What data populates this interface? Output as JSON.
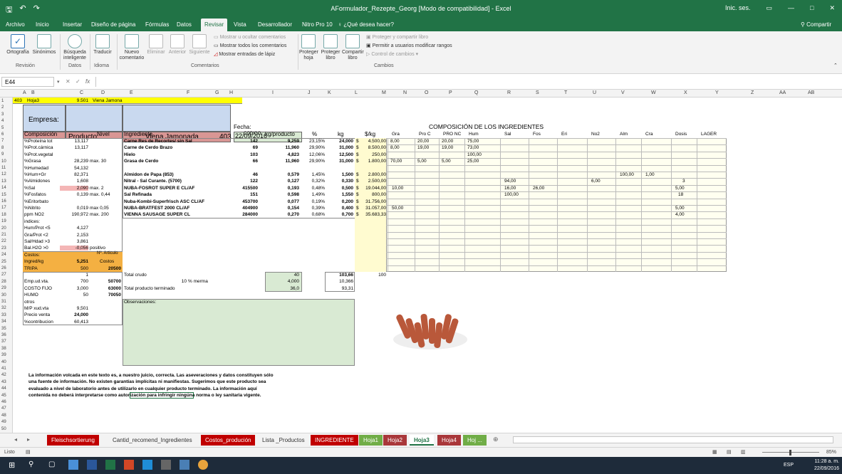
{
  "window": {
    "title": "AFormulador_Rezepte_Georg [Modo de compatibilidad] - Excel",
    "signin": "Inic. ses.",
    "share": "Compartir",
    "min": "—",
    "max": "□",
    "close": "✕"
  },
  "menu": {
    "tabs": [
      "Archivo",
      "Inicio",
      "Insertar",
      "Diseño de página",
      "Fórmulas",
      "Datos",
      "Revisar",
      "Vista",
      "Desarrollador",
      "Nitro Pro 10"
    ],
    "tell": "¿Qué desea hacer?"
  },
  "ribbon": {
    "ortografia": "Ortografía",
    "sinonimos": "Sinónimos",
    "busqueda": "Búsqueda inteligente",
    "traducir": "Traducir",
    "nuevo": "Nuevo comentario",
    "eliminar": "Eliminar",
    "anterior": "Anterior",
    "siguiente": "Siguiente",
    "mostrar_ocultar": "Mostrar u ocultar comentarios",
    "mostrar_todos": "Mostrar todos los comentarios",
    "mostrar_lapiz": "Mostrar entradas de lápiz",
    "proteger_hoja": "Proteger hoja",
    "proteger_libro": "Proteger libro",
    "compartir_libro": "Compartir libro",
    "proteger_compartir": "Proteger y compartir libro",
    "permitir": "Permitir a usuarios modificar rangos",
    "control": "Control de cambios",
    "groups": {
      "revision": "Revisión",
      "datos": "Datos",
      "idioma": "Idioma",
      "comentarios": "Comentarios",
      "cambios": "Cambios"
    }
  },
  "formula": {
    "cell": "E44",
    "fx": "fx"
  },
  "columns": [
    "A",
    "B",
    "C",
    "D",
    "E",
    "F",
    "G",
    "H",
    "I",
    "J",
    "K",
    "L",
    "M",
    "N",
    "O",
    "P",
    "Q",
    "R",
    "S",
    "T",
    "U",
    "V",
    "W",
    "X",
    "Y",
    "Z",
    "AA",
    "AB"
  ],
  "sheet": {
    "r1": [
      "403",
      "Hoja3",
      "9.501",
      "Viena Jamona"
    ],
    "empresa": "Empresa:",
    "producto": "Producto:",
    "producto_nombre": "Viena Jamonada",
    "producto_num": "403",
    "fecha_lbl": "Fecha:",
    "fecha": "22/09/2016",
    "heading": "COMPOSICIÓN DE LOS INGREDIENTES",
    "hdr": {
      "composicion": "Composición",
      "nivel": "Nivel",
      "ingrediente": "Ingrediente",
      "codigo": "CODIGO",
      "kgprod": "kg/producto",
      "pct": "%",
      "kg": "kg",
      "skg": "$/kg"
    },
    "comp_hdr": [
      "Gra",
      "Pro C",
      "PRO NC",
      "Hum",
      "Sal",
      "Fos",
      "Eri",
      "No2",
      "Alm",
      "Cra",
      "Dosis",
      "LAGER"
    ],
    "left": [
      [
        "%Proteína tot",
        "13,117",
        ""
      ],
      [
        "%Prot.cárnica",
        "13,117",
        ""
      ],
      [
        "%Prot.vegetal",
        "",
        ""
      ],
      [
        "%Grasa",
        "28,239",
        "max. 30"
      ],
      [
        "%Humedad",
        "54,132",
        ""
      ],
      [
        "%Hum+Gr",
        "82,371",
        ""
      ],
      [
        "%Almidones",
        "1,608",
        ""
      ],
      [
        "%Sal",
        "2,090",
        "max. 2"
      ],
      [
        "%Fosfatos",
        "0,139",
        "max. 0,44"
      ],
      [
        "%Eritorbato",
        "",
        ""
      ],
      [
        "%Nitrito",
        "0,019",
        "max 0,05"
      ],
      [
        "ppm NO2",
        "190,972",
        "max. 200"
      ],
      [
        "indices:",
        "",
        ""
      ],
      [
        "Hum/Prot <5",
        "4,127",
        ""
      ],
      [
        "Gra/Prot <2",
        "2,153",
        ""
      ],
      [
        "Sal/Hdad >3",
        "3,861",
        ""
      ],
      [
        "Bal.H2O >0",
        "-0,056",
        "positivo"
      ]
    ],
    "ingredients": [
      [
        "Carne Res de Recortes/ sin Sal",
        "142",
        "9,259",
        "23,15%",
        "24,000",
        "$",
        "4.500,00"
      ],
      [
        "Carne de Cerdo Brazo",
        "69",
        "11,960",
        "29,90%",
        "31,000",
        "$",
        "8.500,00"
      ],
      [
        "Hielo",
        "103",
        "4,823",
        "12,06%",
        "12,500",
        "$",
        "250,00"
      ],
      [
        "Grasa de Cerdo",
        "66",
        "11,960",
        "29,90%",
        "31,000",
        "$",
        "1.800,00"
      ],
      [
        "",
        "",
        "",
        "",
        "",
        "",
        ""
      ],
      [
        "Almidon de Papa (853)",
        "46",
        "0,579",
        "1,45%",
        "1,500",
        "$",
        "2.800,00"
      ],
      [
        "Nitral - Sal Curante. (5700)",
        "122",
        "0,127",
        "0,32%",
        "0,330",
        "$",
        "2.500,00"
      ],
      [
        "NUBA-FOSROT SUPER E CL/AF",
        "415500",
        "0,193",
        "0,48%",
        "0,500",
        "$",
        "19.044,00"
      ],
      [
        "Sal Refinada",
        "151",
        "0,598",
        "1,49%",
        "1,550",
        "$",
        "800,00"
      ],
      [
        "Nuba-Kombi-Superfrisch ASC CL/AF",
        "453700",
        "0,077",
        "0,19%",
        "0,200",
        "$",
        "31.756,00"
      ],
      [
        "NUBA-BRATFEST 2000 CL/AF",
        "404900",
        "0,154",
        "0,39%",
        "0,400",
        "$",
        "31.057,00"
      ],
      [
        "VIENNA SAUSAGE SUPER CL",
        "284000",
        "0,270",
        "0,68%",
        "0,700",
        "$",
        "35.683,33"
      ]
    ],
    "comp_vals": [
      [
        [
          "8,00",
          "20,00",
          "20,00",
          "75,00"
        ]
      ],
      [
        [
          "8,00",
          "19,00",
          "19,00",
          "73,00"
        ]
      ],
      [
        [
          "",
          "",
          "",
          "100,00"
        ]
      ],
      [
        [
          "70,00",
          "5,00",
          "5,00",
          "25,00"
        ]
      ]
    ],
    "extra_vals": {
      "alm": "100,00",
      "cra": "1,00",
      "no2": "6,00",
      "dos1": "3",
      "sal1": "94,00",
      "sal_fos": "16,00",
      "fos": "26,00",
      "dos2": "5,00",
      "sal2": "100,00",
      "dos3": "18",
      "gra": "50,00",
      "dos4": "5,00",
      "dos5": "4,00",
      "sal_ref": "10,00"
    },
    "costos": {
      "lbl": "Costos:",
      "art": "Nº. Articulo",
      "ingred": "Ingred/kg",
      "ingred_v": "5,251",
      "costos_lbl": "Costos",
      "tripa": "TRIPA",
      "tripa_v": "500",
      "tripa_a": "20500"
    },
    "bottom_left": [
      [
        "",
        "1",
        ""
      ],
      [
        "Emp.ud.vta.",
        "700",
        "50700"
      ],
      [
        "COSTO FIJO",
        "3,000",
        "63000"
      ],
      [
        "HUMO",
        "50",
        "70050"
      ],
      [
        "otros",
        "",
        ""
      ],
      [
        "M/P xud.vta",
        "9,501",
        ""
      ],
      [
        "Precio venta",
        "24,000",
        ""
      ],
      [
        "%contribucion",
        "60,413",
        ""
      ]
    ],
    "totals": {
      "crudo": "Total crudo",
      "merma_n": "10",
      "merma": "% merma",
      "terminado": "Total producto terminado",
      "c40": "40",
      "k103": "103,66",
      "l100": "100",
      "c4": "4,000",
      "k10": "10,366",
      "c36": "36,0",
      "k93": "93,31"
    },
    "obs": "Observaciones:",
    "disclaimer": [
      "La información volcada en este texto es, a nuestro juicio, correcta.  Las aseveraciones y datos constituyen sólo",
      "una fuente de información.  No existen garantías implícitas ni manifiestas.  Sugerimos que este producto sea",
      "evaluado a nivel de laboratorio antes de utilizarlo en cualquier producto terminado. La información aquí",
      "contenida no deberá interpretarse como autorización para infringir ningúna norma o ley sanitaria vigente."
    ]
  },
  "tabs": [
    {
      "label": "Fleischsortierung",
      "bg": "#c00000",
      "fg": "#fff"
    },
    {
      "label": "Cantid_recomend_Ingredientes",
      "bg": "#f3f3f3",
      "fg": "#333"
    },
    {
      "label": "Costos_produción",
      "bg": "#c00000",
      "fg": "#fff"
    },
    {
      "label": "Lista _Productos",
      "bg": "#f3f3f3",
      "fg": "#333"
    },
    {
      "label": "INGREDIENTE",
      "bg": "#c00000",
      "fg": "#fff"
    },
    {
      "label": "Hoja1",
      "bg": "#70ad47",
      "fg": "#fff"
    },
    {
      "label": "Hoja2",
      "bg": "#a9373a",
      "fg": "#fff"
    },
    {
      "label": "Hoja3",
      "bg": "#ffffff",
      "fg": "#217346"
    },
    {
      "label": "Hoja4",
      "bg": "#a9373a",
      "fg": "#fff"
    },
    {
      "label": "Hoj ...",
      "bg": "#70ad47",
      "fg": "#fff"
    }
  ],
  "status": {
    "mode": "Listo",
    "zoom": "85%"
  },
  "taskbar": {
    "lang": "ESP",
    "time": "11:28 a. m.",
    "date": "22/09/2016"
  }
}
